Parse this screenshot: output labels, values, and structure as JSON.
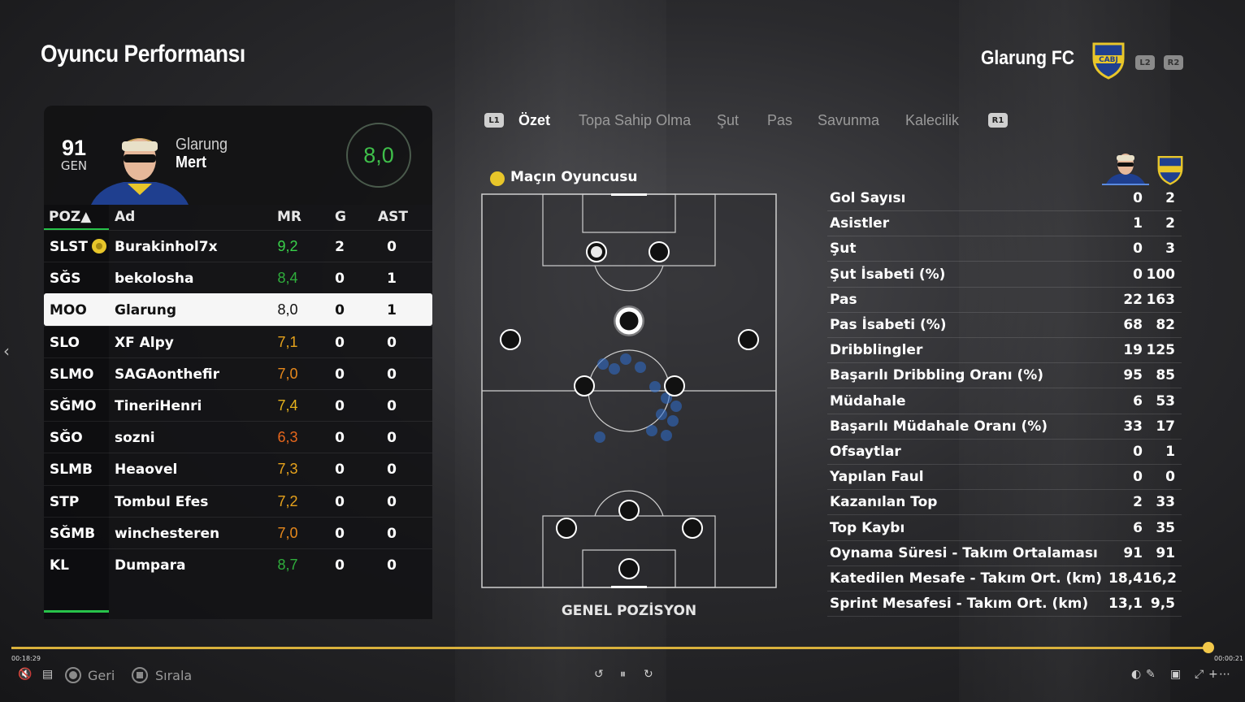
{
  "page": {
    "title": "Oyuncu Performansı",
    "team_name": "Glarung FC",
    "crest_text": "CABJ",
    "shoulder_left": "L2",
    "shoulder_right": "R2"
  },
  "player": {
    "overall": "91",
    "overall_label": "GEN",
    "first_name": "Glarung",
    "last_name": "Mert",
    "match_rating": "8,0"
  },
  "table": {
    "headers": {
      "pos": "POZ▲",
      "name": "Ad",
      "mr": "MR",
      "g": "G",
      "ast": "AST"
    },
    "rows": [
      {
        "pos": "SLST",
        "name": "Burakinhol7x",
        "mr": "9,2",
        "g": "0",
        "ast": "0",
        "g_val": "2",
        "mr_color": "#39d14a",
        "motm": true
      },
      {
        "pos": "SĞS",
        "name": "bekolosha",
        "mr": "8,4",
        "g": "0",
        "ast": "1",
        "mr_color": "#2fae3c"
      },
      {
        "pos": "MOO",
        "name": "Glarung",
        "mr": "8,0",
        "g": "0",
        "ast": "1",
        "mr_color": "#111111",
        "selected": true
      },
      {
        "pos": "SLO",
        "name": "XF Alpy",
        "mr": "7,1",
        "g": "0",
        "ast": "0",
        "mr_color": "#e6a21c"
      },
      {
        "pos": "SLMO",
        "name": "SAGAonthefir",
        "mr": "7,0",
        "g": "0",
        "ast": "0",
        "mr_color": "#e6881c"
      },
      {
        "pos": "SĞMO",
        "name": "TineriHenri",
        "mr": "7,4",
        "g": "0",
        "ast": "0",
        "mr_color": "#e6b21c"
      },
      {
        "pos": "SĞO",
        "name": "sozni",
        "mr": "6,3",
        "g": "0",
        "ast": "0",
        "mr_color": "#e6661c"
      },
      {
        "pos": "SLMB",
        "name": "Heaovel",
        "mr": "7,3",
        "g": "0",
        "ast": "0",
        "mr_color": "#e6a21c"
      },
      {
        "pos": "STP",
        "name": "Tombul Efes",
        "mr": "7,2",
        "g": "0",
        "ast": "0",
        "mr_color": "#e6a21c"
      },
      {
        "pos": "SĞMB",
        "name": "winchesteren",
        "mr": "7,0",
        "g": "0",
        "ast": "0",
        "mr_color": "#e6881c"
      },
      {
        "pos": "KL",
        "name": "Dumpara",
        "mr": "8,7",
        "g": "0",
        "ast": "0",
        "mr_color": "#2fae3c"
      }
    ]
  },
  "tabs": {
    "left_btn": "L1",
    "right_btn": "R1",
    "items": [
      "Özet",
      "Topa Sahip Olma",
      "Şut",
      "Pas",
      "Savunma",
      "Kalecilik"
    ],
    "active": "Özet"
  },
  "motm_label": "Maçın Oyuncusu",
  "pitch_caption": "GENEL POZİSYON",
  "stats": [
    {
      "label": "Gol Sayısı",
      "player": "0",
      "team": "2"
    },
    {
      "label": "Asistler",
      "player": "1",
      "team": "2"
    },
    {
      "label": "Şut",
      "player": "0",
      "team": "3"
    },
    {
      "label": "Şut İsabeti (%)",
      "player": "0",
      "team": "100"
    },
    {
      "label": "Pas",
      "player": "22",
      "team": "163"
    },
    {
      "label": "Pas İsabeti (%)",
      "player": "68",
      "team": "82"
    },
    {
      "label": "Dribblingler",
      "player": "19",
      "team": "125"
    },
    {
      "label": "Başarılı Dribbling Oranı (%)",
      "player": "95",
      "team": "85"
    },
    {
      "label": "Müdahale",
      "player": "6",
      "team": "53"
    },
    {
      "label": "Başarılı Müdahale Oranı (%)",
      "player": "33",
      "team": "17"
    },
    {
      "label": "Ofsaytlar",
      "player": "0",
      "team": "1"
    },
    {
      "label": "Yapılan Faul",
      "player": "0",
      "team": "0"
    },
    {
      "label": "Kazanılan Top",
      "player": "2",
      "team": "33"
    },
    {
      "label": "Top Kaybı",
      "player": "6",
      "team": "35"
    },
    {
      "label": "Oynama Süresi - Takım Ortalaması",
      "player": "91",
      "team": "91"
    },
    {
      "label": "Katedilen Mesafe - Takım Ort. (km)",
      "player": "18,4",
      "team": "16,2"
    },
    {
      "label": "Sprint Mesafesi - Takım Ort. (km)",
      "player": "13,1",
      "team": "9,5"
    }
  ],
  "playback": {
    "time_elapsed": "00:18:29",
    "time_remaining": "00:00:21",
    "progress": 0.99,
    "back_label": "Geri",
    "sort_label": "Sırala"
  },
  "colors": {
    "accent_green": "#27c24a",
    "gold": "#e8c62a",
    "progress": "#d9b13c",
    "crest_blue": "#1f3f8f"
  }
}
